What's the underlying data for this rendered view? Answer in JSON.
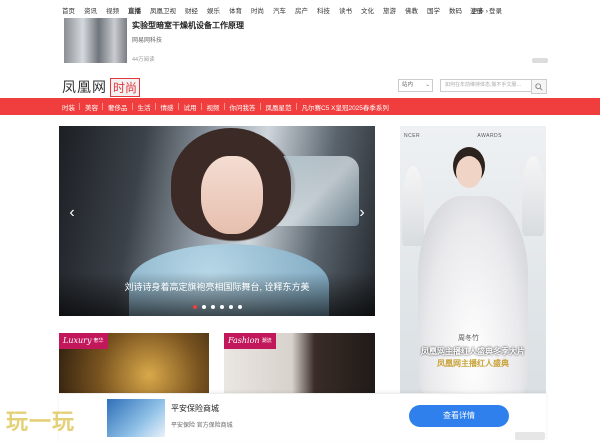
{
  "topnav": {
    "items": [
      "首页",
      "资讯",
      "视频",
      "直播",
      "凤凰卫视",
      "财经",
      "娱乐",
      "体育",
      "时尚",
      "汽车",
      "房产",
      "科技",
      "读书",
      "文化",
      "旅游",
      "佛教",
      "国学",
      "数码",
      "更多 ›"
    ],
    "login": "注册",
    "register": "登录"
  },
  "top_ad": {
    "title": "实验型暗室干燥机设备工作原理",
    "source": "网易网科技",
    "count": "44万阅读"
  },
  "header": {
    "logo": "凤凰网",
    "channel": "时尚",
    "search_scope": "站内",
    "search_placeholder": "如何在年前维持体态,做不手文服…"
  },
  "rednav": [
    "时装",
    "美容",
    "奢侈品",
    "生活",
    "情感",
    "试用",
    "视频",
    "你问我答",
    "凤凰星范",
    "凡尔赛C5 X皇冠2025春季系列"
  ],
  "slider": {
    "caption": "刘诗诗身着高定旗袍亮相国际舞台, 诠释东方美",
    "dots": 6,
    "active_dot": 1
  },
  "right_card": {
    "hdr_left": "NCER",
    "hdr_right": "AWARDS",
    "watermark": "周冬竹",
    "headline": "凤凰网主播红人盛典冬季大片",
    "headline2": "凤凰网主播红人盛典"
  },
  "cards": [
    {
      "tag": "Luxury",
      "tag_cn": "奢华"
    },
    {
      "tag": "Fashion",
      "tag_cn": "潮流"
    }
  ],
  "bottom_ad": {
    "title": "平安保险商城",
    "sub": "平安保险 官方保险商城",
    "button": "查看详情"
  },
  "watermark": "玩一玩"
}
